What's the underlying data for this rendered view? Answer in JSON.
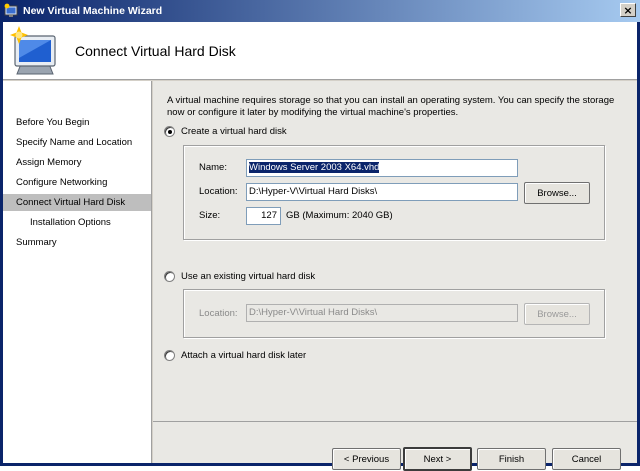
{
  "window": {
    "title": "New Virtual Machine Wizard",
    "close_glyph": "×"
  },
  "header": {
    "title": "Connect Virtual Hard Disk",
    "icon": "new-vm-monitor-icon"
  },
  "nav": {
    "items": [
      {
        "label": "Before You Begin"
      },
      {
        "label": "Specify Name and Location"
      },
      {
        "label": "Assign Memory"
      },
      {
        "label": "Configure Networking"
      },
      {
        "label": "Connect Virtual Hard Disk"
      },
      {
        "label": "Installation Options"
      },
      {
        "label": "Summary"
      }
    ],
    "selected": "Connect Virtual Hard Disk"
  },
  "content": {
    "description": "A virtual machine requires storage so that you can install an operating system. You can specify the storage now or configure it later by modifying the virtual machine's properties.",
    "create_option": {
      "label": "Create a virtual hard disk",
      "checked": true,
      "name_label": "Name:",
      "name_value": "Windows Server 2003 X64.vhd",
      "location_label": "Location:",
      "location_value": "D:\\Hyper-V\\Virtual Hard Disks\\",
      "browse_label": "Browse...",
      "size_label": "Size:",
      "size_value": "127",
      "size_unit": "GB (Maximum: 2040 GB)"
    },
    "existing_option": {
      "label": "Use an existing virtual hard disk",
      "checked": false,
      "location_label": "Location:",
      "location_value": "D:\\Hyper-V\\Virtual Hard Disks\\",
      "browse_label": "Browse..."
    },
    "later_option": {
      "label": "Attach a virtual hard disk later",
      "checked": false
    }
  },
  "footer": {
    "previous_label": "< Previous",
    "next_label": "Next >",
    "finish_label": "Finish",
    "cancel_label": "Cancel"
  },
  "colors": {
    "titlebar": "#0a246a",
    "selection": "#0a246a",
    "nav_selected": "#bebebe"
  }
}
